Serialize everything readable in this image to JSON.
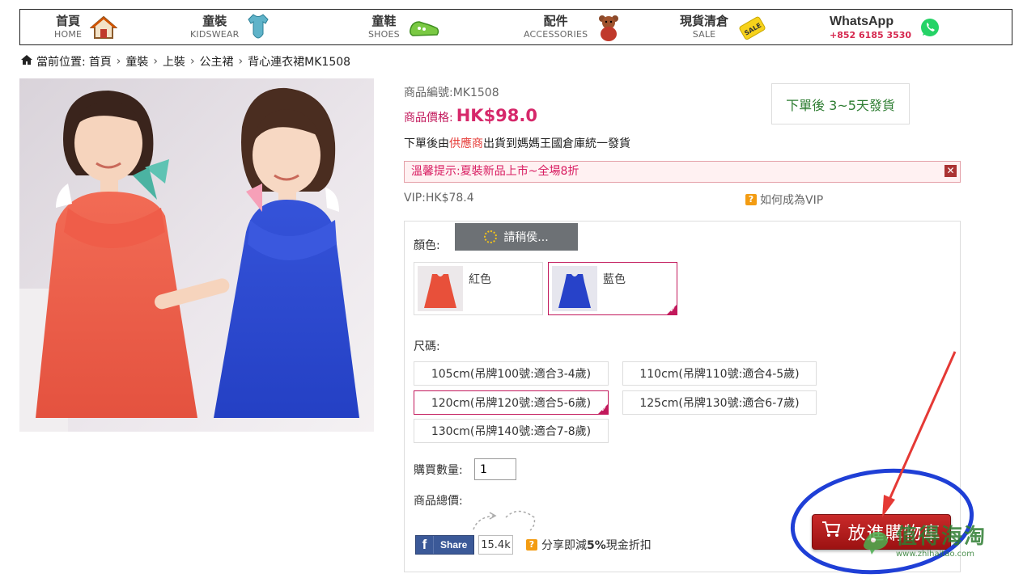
{
  "nav": {
    "items": [
      {
        "zh": "首頁",
        "en": "HOME",
        "icon": "house-icon"
      },
      {
        "zh": "童裝",
        "en": "KIDSWEAR",
        "icon": "onesie-icon"
      },
      {
        "zh": "童鞋",
        "en": "SHOES",
        "icon": "shoe-icon"
      },
      {
        "zh": "配件",
        "en": "ACCESSORIES",
        "icon": "teddy-bear-icon"
      },
      {
        "zh": "現貨清倉",
        "en": "SALE",
        "icon": "sale-tag-icon"
      }
    ],
    "whatsapp": {
      "title": "WhatsApp",
      "phone": "+852 6185 3530",
      "icon": "whatsapp-icon"
    }
  },
  "breadcrumb": {
    "prefix": "當前位置:",
    "items": [
      "首頁",
      "童裝",
      "上裝",
      "公主裙",
      "背心連衣裙MK1508"
    ]
  },
  "product": {
    "sku_label": "商品編號:",
    "sku": "MK1508",
    "price_label": "商品價格:",
    "price": "HK$98.0",
    "shipping_note": "下單後 3~5天發貨",
    "dispatch_prefix": "下單後由",
    "dispatch_supplier": "供應商",
    "dispatch_suffix": "出貨到媽媽王國倉庫統一發貨",
    "notice": "溫馨提示:夏裝新品上市~全場8折",
    "vip_label": "VIP:",
    "vip_price": "HK$78.4",
    "vip_help": "如何成為VIP"
  },
  "options": {
    "color_label": "顏色:",
    "loading_text": "請稍侯...",
    "colors": [
      {
        "name": "紅色",
        "selected": false,
        "swatch": "#e8503a"
      },
      {
        "name": "藍色",
        "selected": true,
        "swatch": "#2742c9"
      }
    ],
    "size_label": "尺碼:",
    "sizes": [
      {
        "label": "105cm(吊牌100號:適合3-4歲)",
        "selected": false
      },
      {
        "label": "110cm(吊牌110號:適合4-5歲)",
        "selected": false
      },
      {
        "label": "120cm(吊牌120號:適合5-6歲)",
        "selected": true
      },
      {
        "label": "125cm(吊牌130號:適合6-7歲)",
        "selected": false
      },
      {
        "label": "130cm(吊牌140號:適合7-8歲)",
        "selected": false
      }
    ],
    "qty_label": "購買數量:",
    "qty_value": "1",
    "total_label": "商品總價:"
  },
  "share": {
    "button_label": "Share",
    "count": "15.4k",
    "note_prefix": "分享即減",
    "note_bold": "5%",
    "note_suffix": "現金折扣"
  },
  "cart": {
    "label": "放進購物車"
  },
  "watermark": {
    "text": "值得海淘",
    "url": "www.zhihaitao.com"
  },
  "colors": {
    "accent": "#c2185b",
    "price": "#d6286a",
    "ship_green": "#2e7d32",
    "cart_red": "#b71c1c",
    "annotation_blue": "#1f3fd6"
  }
}
